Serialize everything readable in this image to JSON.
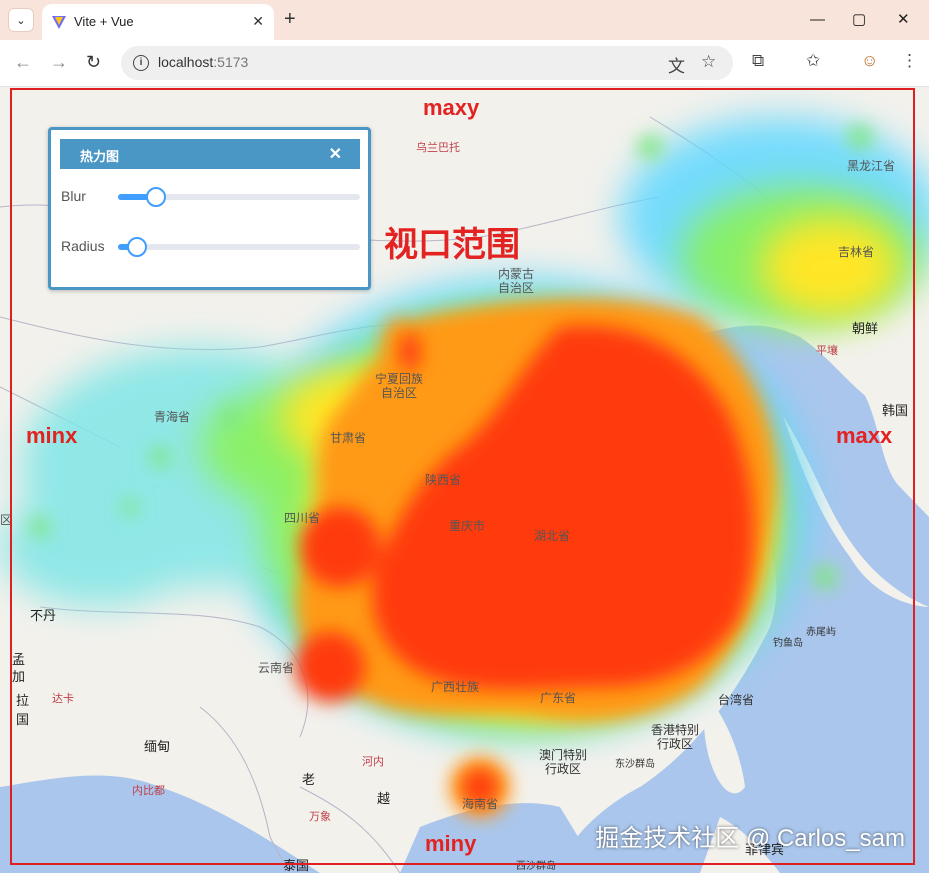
{
  "browser": {
    "tab_title": "Vite + Vue",
    "tab_close": "✕",
    "new_tab": "+",
    "tab_menu": "⌄",
    "url_host": "localhost",
    "url_port": ":5173",
    "window_controls": {
      "minimize": "—",
      "maximize": "▢",
      "close": "✕"
    },
    "nav": {
      "back": "←",
      "forward": "→",
      "reload": "↻"
    },
    "icons": [
      "translate-icon",
      "star-icon",
      "extensions-icon",
      "bookmarks-icon",
      "profile-icon",
      "more-icon"
    ]
  },
  "panel": {
    "title": "热力图",
    "close": "✕",
    "sliders": [
      {
        "label": "Blur",
        "value": 0.15
      },
      {
        "label": "Radius",
        "value": 0.07
      }
    ],
    "accent_color": "#4a96c4",
    "slider_color": "#409eff"
  },
  "annotations": {
    "viewport": "视口范围",
    "maxy": "maxy",
    "miny": "miny",
    "minx": "minx",
    "maxx": "maxx",
    "box_color": "#e02020"
  },
  "map_labels": {
    "wulanbatuo": "乌兰巴托",
    "heilongjiang": "黑龙江省",
    "jilin": "吉林省",
    "neimenggu": "内蒙古\n自治区",
    "chaoxian": "朝鲜",
    "pingrang": "平壤",
    "hanguo": "韩国",
    "ningxia": "宁夏回族\n自治区",
    "qinghai": "青海省",
    "gansu": "甘肃省",
    "shaanxi": "陕西省",
    "sichuan": "四川省",
    "chongqing": "重庆市",
    "hubei": "湖北省",
    "budan": "不丹",
    "meng": "孟\n加",
    "la": "拉\n国",
    "daka": "达卡",
    "miandian": "缅甸",
    "neibidu": "内比都",
    "lao": "老",
    "yue": "越",
    "hanoi": "河内",
    "wanxiang": "万象",
    "taiguo": "泰国",
    "yunnan": "云南省",
    "guangxi": "广西壮族",
    "guangdong": "广东省",
    "hainan": "海南省",
    "taiwan": "台湾省",
    "diaoyudao": "钓鱼岛",
    "chiweiyu": "赤尾屿",
    "hongkong": "香港特别\n行政区",
    "macau": "澳门特别\n行政区",
    "dongsha": "东沙群岛",
    "xisha": "西沙群岛",
    "feilvbin": "菲律宾",
    "qu": "区"
  },
  "watermark": "掘金技术社区 @ Carlos_sam"
}
